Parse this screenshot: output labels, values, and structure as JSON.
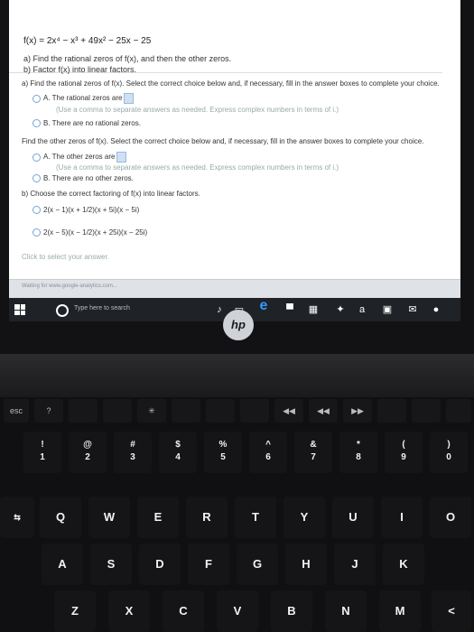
{
  "question": {
    "function": "f(x) = 2x⁴ − x³ + 49x² − 25x − 25",
    "part_a": "a) Find the rational zeros of f(x), and then the other zeros.",
    "part_b": "b) Factor f(x) into linear factors."
  },
  "answer": {
    "a_prompt": "a) Find the rational zeros of f(x). Select the correct choice below and, if necessary, fill in the answer boxes to complete your choice.",
    "a_choice_a": "A.  The rational zeros are",
    "a_choice_a_hint": "(Use a comma to separate answers as needed. Express complex numbers in terms of i.)",
    "a_choice_b": "B.  There are no rational zeros.",
    "other_prompt": "Find the other zeros of f(x). Select the correct choice below and, if necessary, fill in the answer boxes to complete your choice.",
    "other_choice_a": "A.  The other zeros are",
    "other_choice_a_hint": "(Use a comma to separate answers as needed. Express complex numbers in terms of i.)",
    "other_choice_b": "B.  There are no other zeros.",
    "b_prompt": "b) Choose the correct factoring of f(x) into linear factors.",
    "factor_1": "2(x − 1)(x + 1/2)(x + 5i)(x − 5i)",
    "factor_2": "2(x − 5)(x − 1/2)(x + 25i)(x − 25i)",
    "click_hint": "Click to select your answer."
  },
  "status": "Waiting for www.google-analytics.com...",
  "taskbar": {
    "search_placeholder": "Type here to search",
    "store_letter": "a"
  },
  "brand": "hp",
  "fkeys": [
    "esc",
    "?",
    "",
    "",
    "✳",
    "",
    "",
    "",
    "◀◀",
    "◀◀",
    "▶▶",
    "",
    "",
    ""
  ],
  "keys": {
    "numbers": [
      "!\n1",
      "@\n2",
      "#\n3",
      "$\n4",
      "%\n5",
      "^\n6",
      "&\n7",
      "*\n8",
      "(\n9",
      ")\n0"
    ],
    "qrow": [
      "Q",
      "W",
      "E",
      "R",
      "T",
      "Y",
      "U",
      "I",
      "O"
    ],
    "arow": [
      "A",
      "S",
      "D",
      "F",
      "G",
      "H",
      "J",
      "K"
    ],
    "zrow": [
      "Z",
      "X",
      "C",
      "V",
      "B",
      "N",
      "M",
      "<"
    ]
  }
}
